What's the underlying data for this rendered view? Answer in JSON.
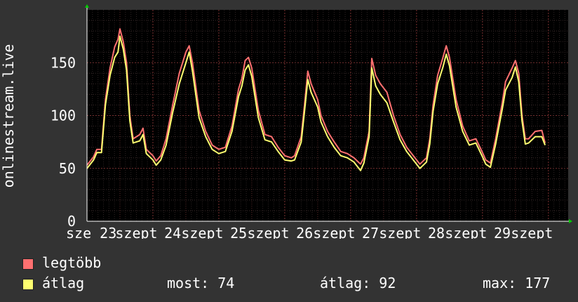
{
  "chart_data": {
    "type": "line",
    "ylabel": "onlinestream.live",
    "ylim": [
      0,
      200
    ],
    "yticks": [
      0,
      50,
      100,
      150
    ],
    "xlim": [
      0,
      7.3
    ],
    "xticks": [
      {
        "label": "sze 23",
        "x": 0
      },
      {
        "label": "szept",
        "x": 0.75
      },
      {
        "label": "24",
        "x": 1.3
      },
      {
        "label": "szept",
        "x": 1.75
      },
      {
        "label": "25",
        "x": 2.3
      },
      {
        "label": "szept",
        "x": 2.75
      },
      {
        "label": "26",
        "x": 3.3
      },
      {
        "label": "szept",
        "x": 3.75
      },
      {
        "label": "27",
        "x": 4.3
      },
      {
        "label": "szept",
        "x": 4.75
      },
      {
        "label": "28",
        "x": 5.3
      },
      {
        "label": "szept",
        "x": 5.75
      },
      {
        "label": "29",
        "x": 6.3
      },
      {
        "label": "szept",
        "x": 6.75
      }
    ],
    "grid": true,
    "series": [
      {
        "name": "legtöbb",
        "color": "#ff7070",
        "points": [
          [
            0,
            53
          ],
          [
            0.1,
            61
          ],
          [
            0.15,
            68
          ],
          [
            0.22,
            68
          ],
          [
            0.28,
            115
          ],
          [
            0.35,
            145
          ],
          [
            0.42,
            165
          ],
          [
            0.47,
            172
          ],
          [
            0.5,
            182
          ],
          [
            0.55,
            170
          ],
          [
            0.6,
            150
          ],
          [
            0.65,
            100
          ],
          [
            0.7,
            78
          ],
          [
            0.8,
            82
          ],
          [
            0.85,
            88
          ],
          [
            0.9,
            68
          ],
          [
            1.0,
            62
          ],
          [
            1.05,
            57
          ],
          [
            1.12,
            62
          ],
          [
            1.2,
            78
          ],
          [
            1.3,
            110
          ],
          [
            1.4,
            140
          ],
          [
            1.5,
            160
          ],
          [
            1.55,
            166
          ],
          [
            1.6,
            150
          ],
          [
            1.7,
            105
          ],
          [
            1.8,
            85
          ],
          [
            1.9,
            72
          ],
          [
            2.0,
            68
          ],
          [
            2.1,
            70
          ],
          [
            2.2,
            90
          ],
          [
            2.3,
            125
          ],
          [
            2.35,
            135
          ],
          [
            2.4,
            152
          ],
          [
            2.45,
            155
          ],
          [
            2.5,
            145
          ],
          [
            2.6,
            105
          ],
          [
            2.7,
            82
          ],
          [
            2.8,
            80
          ],
          [
            2.9,
            70
          ],
          [
            3.0,
            62
          ],
          [
            3.1,
            60
          ],
          [
            3.15,
            62
          ],
          [
            3.25,
            80
          ],
          [
            3.3,
            110
          ],
          [
            3.35,
            142
          ],
          [
            3.4,
            130
          ],
          [
            3.5,
            115
          ],
          [
            3.55,
            100
          ],
          [
            3.65,
            85
          ],
          [
            3.75,
            75
          ],
          [
            3.85,
            66
          ],
          [
            3.95,
            64
          ],
          [
            4.05,
            60
          ],
          [
            4.15,
            54
          ],
          [
            4.2,
            60
          ],
          [
            4.28,
            85
          ],
          [
            4.32,
            154
          ],
          [
            4.38,
            138
          ],
          [
            4.45,
            130
          ],
          [
            4.55,
            122
          ],
          [
            4.65,
            100
          ],
          [
            4.75,
            82
          ],
          [
            4.85,
            70
          ],
          [
            4.95,
            62
          ],
          [
            5.05,
            54
          ],
          [
            5.15,
            60
          ],
          [
            5.2,
            78
          ],
          [
            5.25,
            110
          ],
          [
            5.32,
            138
          ],
          [
            5.4,
            155
          ],
          [
            5.45,
            166
          ],
          [
            5.5,
            155
          ],
          [
            5.6,
            115
          ],
          [
            5.7,
            90
          ],
          [
            5.8,
            76
          ],
          [
            5.9,
            78
          ],
          [
            6.0,
            65
          ],
          [
            6.05,
            58
          ],
          [
            6.12,
            55
          ],
          [
            6.2,
            78
          ],
          [
            6.3,
            112
          ],
          [
            6.35,
            132
          ],
          [
            6.45,
            145
          ],
          [
            6.5,
            152
          ],
          [
            6.55,
            140
          ],
          [
            6.6,
            100
          ],
          [
            6.65,
            78
          ],
          [
            6.7,
            78
          ],
          [
            6.8,
            85
          ],
          [
            6.9,
            86
          ],
          [
            6.95,
            74
          ]
        ]
      },
      {
        "name": "átlag",
        "color": "#ffff70",
        "points": [
          [
            0,
            50
          ],
          [
            0.1,
            58
          ],
          [
            0.15,
            65
          ],
          [
            0.22,
            65
          ],
          [
            0.28,
            110
          ],
          [
            0.35,
            138
          ],
          [
            0.42,
            155
          ],
          [
            0.47,
            160
          ],
          [
            0.5,
            175
          ],
          [
            0.55,
            163
          ],
          [
            0.6,
            143
          ],
          [
            0.65,
            95
          ],
          [
            0.7,
            74
          ],
          [
            0.8,
            76
          ],
          [
            0.85,
            82
          ],
          [
            0.9,
            64
          ],
          [
            1.0,
            58
          ],
          [
            1.05,
            53
          ],
          [
            1.12,
            58
          ],
          [
            1.2,
            72
          ],
          [
            1.3,
            103
          ],
          [
            1.4,
            130
          ],
          [
            1.5,
            150
          ],
          [
            1.55,
            160
          ],
          [
            1.6,
            142
          ],
          [
            1.7,
            98
          ],
          [
            1.8,
            80
          ],
          [
            1.9,
            68
          ],
          [
            2.0,
            64
          ],
          [
            2.1,
            66
          ],
          [
            2.2,
            85
          ],
          [
            2.3,
            118
          ],
          [
            2.35,
            128
          ],
          [
            2.4,
            143
          ],
          [
            2.45,
            148
          ],
          [
            2.5,
            137
          ],
          [
            2.6,
            98
          ],
          [
            2.7,
            77
          ],
          [
            2.8,
            75
          ],
          [
            2.9,
            66
          ],
          [
            3.0,
            58
          ],
          [
            3.1,
            57
          ],
          [
            3.15,
            58
          ],
          [
            3.25,
            75
          ],
          [
            3.3,
            104
          ],
          [
            3.35,
            134
          ],
          [
            3.4,
            122
          ],
          [
            3.5,
            108
          ],
          [
            3.55,
            94
          ],
          [
            3.65,
            80
          ],
          [
            3.75,
            70
          ],
          [
            3.85,
            62
          ],
          [
            3.95,
            60
          ],
          [
            4.05,
            56
          ],
          [
            4.15,
            48
          ],
          [
            4.2,
            55
          ],
          [
            4.28,
            80
          ],
          [
            4.32,
            145
          ],
          [
            4.38,
            128
          ],
          [
            4.45,
            120
          ],
          [
            4.55,
            112
          ],
          [
            4.65,
            94
          ],
          [
            4.75,
            77
          ],
          [
            4.85,
            66
          ],
          [
            4.95,
            58
          ],
          [
            5.05,
            50
          ],
          [
            5.15,
            56
          ],
          [
            5.2,
            73
          ],
          [
            5.25,
            104
          ],
          [
            5.32,
            130
          ],
          [
            5.4,
            146
          ],
          [
            5.45,
            158
          ],
          [
            5.5,
            147
          ],
          [
            5.6,
            108
          ],
          [
            5.7,
            85
          ],
          [
            5.8,
            72
          ],
          [
            5.9,
            74
          ],
          [
            6.0,
            61
          ],
          [
            6.05,
            54
          ],
          [
            6.12,
            51
          ],
          [
            6.2,
            73
          ],
          [
            6.3,
            106
          ],
          [
            6.35,
            124
          ],
          [
            6.45,
            136
          ],
          [
            6.5,
            146
          ],
          [
            6.55,
            132
          ],
          [
            6.6,
            95
          ],
          [
            6.65,
            73
          ],
          [
            6.7,
            74
          ],
          [
            6.8,
            80
          ],
          [
            6.9,
            80
          ],
          [
            6.95,
            72
          ]
        ]
      }
    ],
    "legend": [
      {
        "label": "legtöbb",
        "color": "#ff7070"
      },
      {
        "label": "átlag",
        "color": "#ffff70"
      }
    ],
    "legend_position": "bottom-left"
  },
  "stats": {
    "most_label": "most:",
    "most_value": "74",
    "atlag_label": "átlag:",
    "atlag_value": "92",
    "max_label": "max:",
    "max_value": "177"
  }
}
